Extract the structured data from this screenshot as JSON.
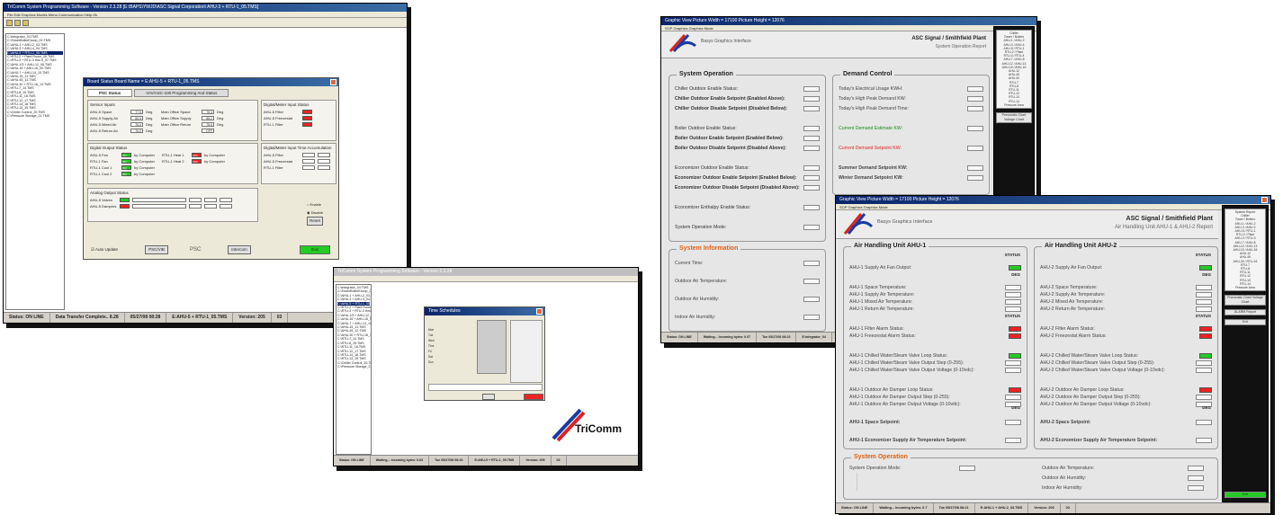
{
  "s1": {
    "title": "TriComm System Programming Software - Version 2.3.28   [E:\\BAPS\\YWJD\\ASC Signal Corporation\\ AHU-3 + RTU-1_05.TMS]",
    "menu": "File  Edit  Graphics  Modes  Menu  Communication  Help  Ok",
    "tree": [
      "C:\\integrator_04.TMS",
      "C:\\TowerBoilerEcoop_02.TMS",
      "C:\\AHU-1 + AHU-2_03.TMS",
      "C:\\AHU-3 + AHU-4_04.TMS",
      "C:\\AHU-5 + RTU-1_05.TMS",
      "C:\\RTU-2 + Plant Room_06.TMS",
      "C:\\RTU-3 + RTU-3 thru 5_07.TMS",
      "C:\\AHU-1/3 + AHU-12_08.TMS",
      "C:\\AHU-16 + AHU-16_09.TMS",
      "C:\\AHU-7 + AHU-14_10.TMS",
      "C:\\AHU-15_11.TMS",
      "C:\\AHU-45_12.TMS",
      "C:\\AHU-30 + RTU-16_13.TMS",
      "C:\\RTU-7_14.TMS",
      "C:\\RTU-8_15.TMS",
      "C:\\RTU-11_16.TMS",
      "C:\\RTU-12_17.TMS",
      "C:\\RTU-14_18.TMS",
      "C:\\RTU-13_19.TMS",
      "C:\\Chiller Control_20.TMS",
      "C:\\Pressure Storage_21.TMS"
    ],
    "status": [
      "Status: ON LINE",
      "Data Transfer Complete.. 8.28",
      "05/27/08 08:28",
      "E:AHU-5 + RTU-1_05.TMS",
      "Version: 205",
      "03"
    ]
  },
  "board": {
    "title": "Board Status      Board Name = E:AHU-5 + RTU-1_05.TMS",
    "tab1": "PSC Status",
    "tab2": "VAV/ASC-100 Programming And Status",
    "sensor_title": "Sensor Inputs",
    "sensors": [
      [
        "AHU-5 Space",
        "77.5",
        "Deg",
        "Main Office Space",
        "75.3",
        "Deg"
      ],
      [
        "AHU-5 Supply Air",
        "69.9",
        "Deg",
        "Main Office Supply",
        "55.2",
        "Deg"
      ],
      [
        "AHU-5 Mixed Air",
        "75.0",
        "Deg",
        "Main Office Return",
        "75.9",
        "Deg"
      ],
      [
        "AHU-5 Return Air",
        "76.0",
        "Deg",
        "",
        "OFF",
        ""
      ]
    ],
    "digin_title": "Digital/Meter Input Status",
    "digin": [
      "AHU-5 Filter",
      "AHU-5 Freezestat",
      "RTU-1 Filter"
    ],
    "digout_title": "Digital Output Status",
    "digout": [
      [
        "AHU-5 Fan",
        "ON",
        "by Computer",
        "RTU-1 Heat 1",
        "OFF",
        "by Computer"
      ],
      [
        "RTU-1 Fan",
        "ON",
        "by Computer",
        "RTU-1 Heat 2",
        "OFF",
        "by Computer"
      ],
      [
        "RTU-1 Cool 1",
        "ON",
        "by Computer",
        "",
        "",
        ""
      ],
      [
        "RTU-1 Cool 2",
        "ON",
        "by Computer",
        "",
        "",
        ""
      ]
    ],
    "accum_title": "Digital/Meter Input Time Accumulation",
    "accum": [
      "AHU-5 Filter",
      "AHU-5 Freezestat",
      "RTU-1 Filter"
    ],
    "analog_title": "Analog Output Status",
    "analog": [
      "AHU-5 Valves",
      "AHU-5 Dampers"
    ],
    "enable": "Enable",
    "disable": "Disable",
    "reset": "Reset",
    "auto": "Auto Update",
    "b1": "PSC/VIB",
    "b2": "PSC",
    "b3": "Intercom",
    "exit": "Exit"
  },
  "s2": {
    "title": "TriComm System Programming Software - Version 2.3.28",
    "dlg": "Time Schedules",
    "status": [
      "Status: ON LINE",
      "Waiting... Incoming bytes: 0.63",
      "Tue 05/27/08 08:26",
      "E:AHU-5 + RTU-1_05.TMS",
      "Version: 205",
      "03"
    ],
    "days": [
      "Mon",
      "Tue",
      "Wed",
      "Thur",
      "Fri",
      "Sat",
      "Sun"
    ],
    "brand": "TriComm"
  },
  "s3": {
    "title": "Graphic View      Picture Width = 17100      Picture Height = 12076",
    "menu": "SOP Graphics   Graphics Mode",
    "brand": "Basys Graphics Interface",
    "plant": "ASC Signal / Smithfield Plant",
    "report": "System Operation Report",
    "sysop": "System Operation",
    "sysop_rows": [
      "Chiller Outdoor Enable Status:",
      "Chiller Outdoor Enable Setpoint (Enabled Above):",
      "Chiller Outdoor Disable Setpoint (Disabled Below):",
      "",
      "Boiler Outdoor Enable Status:",
      "Boiler Outdoor Enable Setpoint (Enabled Below):",
      "Boiler Outdoor Disable Setpoint (Disabled Above):",
      "",
      "Economizer Outdoor Enable Status:",
      "Economizer Outdoor Enable Setpoint (Enabled Below):",
      "Economizer Outdoor Disable Setpoint (Disabled Above):",
      "",
      "Economizer Enthalpy Enable Status:",
      "",
      "System Operation Mode:"
    ],
    "demand": "Demand Control",
    "demand_rows": [
      "Today's Electrical Usage KWH:",
      "Today's High Peak Demand KW:",
      "Today's High Peak Demand Time:",
      "",
      "Current Demand Estimate KW:",
      "",
      "Current Demand Setpoint KW:",
      "",
      "Summer Demand Setpoint KW:",
      "Winter Demand Setpoint KW:"
    ],
    "info": "System Information",
    "info_rows": [
      "Current Time:",
      "Outdoor Air Temperature:",
      "Outdoor Air Humidity:",
      "Indoor Air Humidity:"
    ],
    "side": [
      "Chiller",
      "Tower / Boilers",
      "AHU-1 / AHU-2",
      "AHU-3 / AHU-4",
      "AHU-5 / RTU-1",
      "RTU-2 / Plant",
      "RTU-3 / RTU-4",
      "AHU-7 / AHU-8",
      "AHU-12 / AHU-13",
      "AHU-15 / AHU-16",
      "AHU-12",
      "AHU-45",
      "AHU-30",
      "RTU-7",
      "RTU-8",
      "RTU-11",
      "RTU-12",
      "RTU-13",
      "RTU-14",
      "Pressure Area"
    ],
    "side_btn": "Pneumatic Chart Voltage Chart",
    "status": [
      "Status: ON LINE",
      "Waiting... Incoming bytes: 0.07",
      "Tue 05/27/08 08:23",
      "E:Integrator_04"
    ]
  },
  "s4": {
    "title": "Graphic View      Picture Width = 17100      Picture Height = 12076",
    "menu": "SOP Graphics   Graphics Mode",
    "brand": "Basys Graphics Interface",
    "plant": "ASC Signal / Smithfield Plant",
    "report": "Air Handling Unit AHU-1 & AHU-2 Report",
    "u1": "Air Handling Unit AHU-1",
    "u2": "Air Handling Unit AHU-2",
    "status_h": "STATUS",
    "deg_h": "DEG",
    "u1_rows": [
      "AHU-1 Supply Air Fan Output:",
      "AHU-1 Space Temperature:",
      "AHU-1 Supply Air Temperature:",
      "AHU-1 Mixed Air Temperature:",
      "AHU-1 Return Air Temperature:",
      "AHU-1 Filter Alarm Status:",
      "AHU-1 Freezestat Alarm Status:",
      "AHU-1 Chilled Water/Steam Valve Loop Status:",
      "AHU-1 Chilled Water/Steam Valve Output Step (0-255):",
      "AHU-1 Chilled Water/Steam Valve Output Voltage (0-10vdc):",
      "AHU-1 Outdoor Air Damper Loop Status:",
      "AHU-1 Outdoor Air Damper Output Step (0-255):",
      "AHU-1 Outdoor Air Damper Output Voltage (0-10vdc):",
      "AHU-1 Space Setpoint:",
      "AHU-1 Economizer Supply Air Temperature Setpoint:"
    ],
    "u2_rows": [
      "AHU-2 Supply Air Fan Output:",
      "AHU-2 Space Temperature:",
      "AHU-2 Supply Air Temperature:",
      "AHU-2 Mixed Air Temperature:",
      "AHU-2 Return Air Temperature:",
      "AHU-2 Filter Alarm Status:",
      "AHU-2 Freezestat Alarm Status:",
      "AHU-2 Chilled Water/Steam Valve Loop Status:",
      "AHU-2 Chilled Water/Steam Valve Output Step (0-255):",
      "AHU-2 Chilled Water/Steam Valve Output Voltage (0-10vdc):",
      "AHU-2 Outdoor Air Damper Loop Status:",
      "AHU-2 Outdoor Air Damper Output Step (0-255):",
      "AHU-2 Outdoor Air Damper Output Voltage (0-10vdc):",
      "AHU-2 Space Setpoint:",
      "AHU-2 Economizer Supply Air Temperature Setpoint:"
    ],
    "sysop": "System Operation",
    "sysop_l": "System Operation Mode:",
    "sysop_r": [
      "Outdoor Air Temperature:",
      "Outdoor Air Humidity:",
      "Indoor Air Humidity:"
    ],
    "side": [
      "System Report",
      "Chiller",
      "Tower / Boilers",
      "AHU-1 / AHU-2",
      "AHU-3 / AHU-4",
      "AHU-5 / RTU-1",
      "RTU-2 / Plant",
      "AHU-3 / RTU-3",
      "AHU-7 / AHU-8",
      "AHU-12 / AHU-13",
      "AHU-15 / AHU-16",
      "AHU-12",
      "AHU-45",
      "AHU-30 / RTU-16",
      "RTU-7",
      "RTU-8",
      "RTU-11",
      "RTU-12",
      "RTU-13",
      "RTU-14",
      "Pressure Area"
    ],
    "side_btn1": "Pneumatic Chart Voltage Chart",
    "side_btn2": "ALARM Report",
    "side_btn3": "Exit",
    "side_go": "Exit",
    "status": [
      "Status: ON LINE",
      "Waiting... Incoming bytes: 0.7",
      "Tue 05/27/08 08:21",
      "E:AHU-1 + AHU-2_03.TMS",
      "Version: 205",
      "03"
    ]
  }
}
